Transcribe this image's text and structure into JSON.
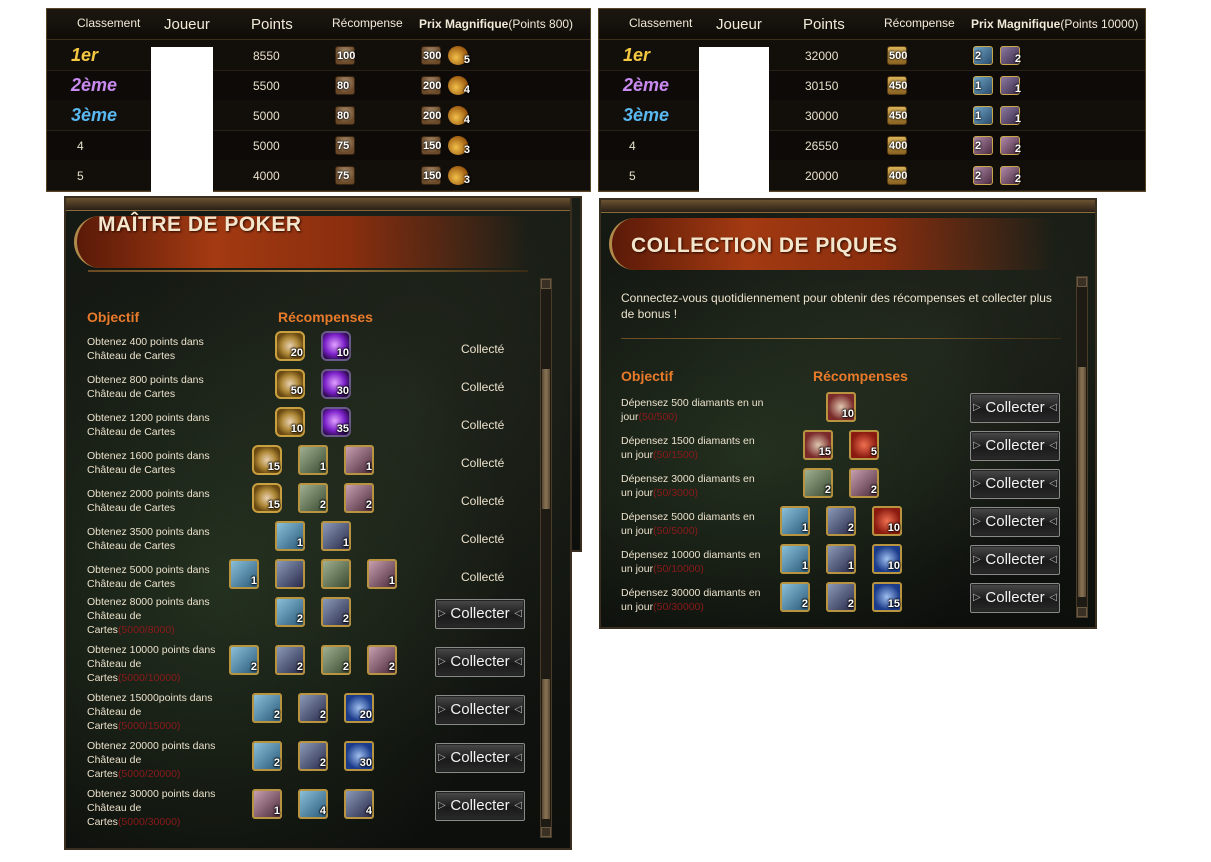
{
  "ranking_left": {
    "headers": {
      "rank": "Classement",
      "player": "Joueur",
      "points": "Points",
      "reward": "Récompense",
      "grand_prize": "Prix Magnifique",
      "grand_prize_note": "(Points 800)"
    },
    "rows": [
      {
        "rank": "1er",
        "points": "8550",
        "reward": "100",
        "prize_a": "300",
        "prize_b": "5",
        "color": "#f5c842"
      },
      {
        "rank": "2ème",
        "points": "5500",
        "reward": "80",
        "prize_a": "200",
        "prize_b": "4",
        "color": "#c98af0"
      },
      {
        "rank": "3ème",
        "points": "5000",
        "reward": "80",
        "prize_a": "200",
        "prize_b": "4",
        "color": "#5ab8f0"
      },
      {
        "rank": "4",
        "points": "5000",
        "reward": "75",
        "prize_a": "150",
        "prize_b": "3",
        "color": "#e8e0cc"
      },
      {
        "rank": "5",
        "points": "4000",
        "reward": "75",
        "prize_a": "150",
        "prize_b": "3",
        "color": "#e8e0cc"
      }
    ]
  },
  "ranking_right": {
    "headers": {
      "rank": "Classement",
      "player": "Joueur",
      "points": "Points",
      "reward": "Récompense",
      "grand_prize": "Prix Magnifique",
      "grand_prize_note": "(Points 10000)"
    },
    "rows": [
      {
        "rank": "1er",
        "points": "32000",
        "reward": "500",
        "prize_a": "2",
        "prize_b": "2",
        "color": "#f5c842"
      },
      {
        "rank": "2ème",
        "points": "30150",
        "reward": "450",
        "prize_a": "1",
        "prize_b": "1",
        "color": "#c98af0"
      },
      {
        "rank": "3ème",
        "points": "30000",
        "reward": "450",
        "prize_a": "1",
        "prize_b": "1",
        "color": "#5ab8f0"
      },
      {
        "rank": "4",
        "points": "26550",
        "reward": "400",
        "prize_a": "2",
        "prize_b": "2",
        "color": "#e8e0cc"
      },
      {
        "rank": "5",
        "points": "20000",
        "reward": "400",
        "prize_a": "2",
        "prize_b": "2",
        "color": "#e8e0cc"
      }
    ]
  },
  "poker_panel": {
    "title": "MAÎTRE DE POKER",
    "objective_header": "Objectif",
    "rewards_header": "Récompenses",
    "collected_label": "Collecté",
    "collect_button": "Collecter",
    "rows": [
      {
        "line1": "Obtenez 400 points dans",
        "line2": "Château de Cartes",
        "progress": "",
        "rewards": [
          "20",
          "10"
        ],
        "status": "Collecté"
      },
      {
        "line1": "Obtenez 800 points dans",
        "line2": "Château de Cartes",
        "progress": "",
        "rewards": [
          "50",
          "30"
        ],
        "status": "Collecté"
      },
      {
        "line1": "Obtenez 1200 points dans",
        "line2": "Château de Cartes",
        "progress": "",
        "rewards": [
          "10",
          "35"
        ],
        "status": "Collecté"
      },
      {
        "line1": "Obtenez 1600 points dans",
        "line2": "Château de Cartes",
        "progress": "",
        "rewards": [
          "15",
          "1",
          "1"
        ],
        "status": "Collecté"
      },
      {
        "line1": "Obtenez 2000 points dans",
        "line2": "Château de Cartes",
        "progress": "",
        "rewards": [
          "15",
          "2",
          "2"
        ],
        "status": "Collecté"
      },
      {
        "line1": "Obtenez 3500 points dans",
        "line2": "Château de Cartes",
        "progress": "",
        "rewards": [
          "1",
          "1"
        ],
        "status": "Collecté"
      },
      {
        "line1": "Obtenez 5000 points dans",
        "line2": "Château de Cartes",
        "progress": "",
        "rewards": [
          "1",
          "",
          "",
          "1"
        ],
        "status": "Collecté"
      },
      {
        "line1": "Obtenez 8000 points dans",
        "line2": "Château de",
        "line3": "Cartes",
        "progress": "(5000/8000)",
        "rewards": [
          "2",
          "2"
        ],
        "status": "button"
      },
      {
        "line1": "Obtenez 10000 points dans",
        "line2": "Château de",
        "line3": "Cartes",
        "progress": "(5000/10000)",
        "rewards": [
          "2",
          "2",
          "2",
          "2"
        ],
        "status": "button"
      },
      {
        "line1": "Obtenez 15000points dans",
        "line2": "Château de",
        "line3": "Cartes",
        "progress": "(5000/15000)",
        "rewards": [
          "2",
          "2",
          "20"
        ],
        "status": "button"
      },
      {
        "line1": "Obtenez 20000 points dans",
        "line2": "Château de",
        "line3": "Cartes",
        "progress": "(5000/20000)",
        "rewards": [
          "2",
          "2",
          "30"
        ],
        "status": "button"
      },
      {
        "line1": "Obtenez 30000 points dans",
        "line2": "Château de",
        "line3": "Cartes",
        "progress": "(5000/30000)",
        "rewards": [
          "1",
          "4",
          "4"
        ],
        "status": "button"
      }
    ]
  },
  "spades_panel": {
    "title": "COLLECTION DE PIQUES",
    "intro": "Connectez-vous quotidiennement pour obtenir des récompenses et collecter plus de bonus !",
    "objective_header": "Objectif",
    "rewards_header": "Récompenses",
    "collect_button": "Collecter",
    "rows": [
      {
        "line1": "Dépensez 500 diamants en un",
        "line2": "jour",
        "progress": "(50/500)",
        "rewards": [
          "10"
        ]
      },
      {
        "line1": "Dépensez 1500 diamants en",
        "line2": "un jour",
        "progress": "(50/1500)",
        "rewards": [
          "15",
          "5"
        ]
      },
      {
        "line1": "Dépensez 3000 diamants en",
        "line2": "un jour",
        "progress": "(50/3000)",
        "rewards": [
          "2",
          "2"
        ]
      },
      {
        "line1": "Dépensez 5000 diamants en",
        "line2": "un jour",
        "progress": "(50/5000)",
        "rewards": [
          "1",
          "2",
          "10"
        ]
      },
      {
        "line1": "Dépensez 10000 diamants en",
        "line2": "un jour",
        "progress": "(50/10000)",
        "rewards": [
          "1",
          "1",
          "10"
        ]
      },
      {
        "line1": "Dépensez 30000 diamants en",
        "line2": "un jour",
        "progress": "(50/30000)",
        "rewards": [
          "2",
          "2",
          "15"
        ]
      }
    ]
  }
}
